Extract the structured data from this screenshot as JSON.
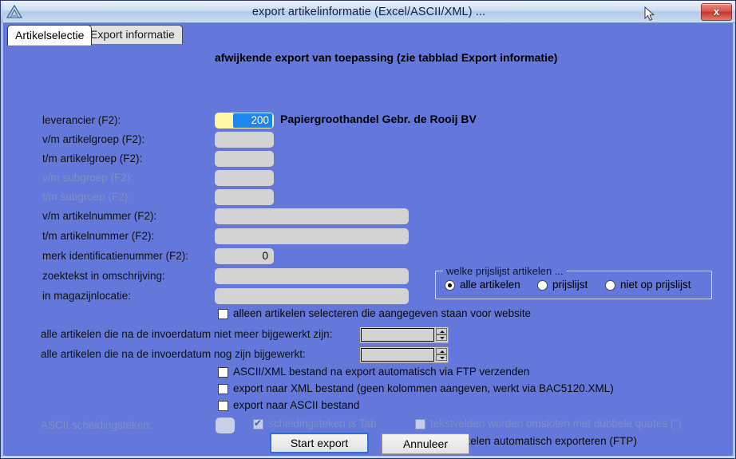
{
  "window": {
    "title": "export artikelinformatie (Excel/ASCII/XML) ...",
    "close_label": "x",
    "app_icon": "triangle-logo-icon"
  },
  "tabs": [
    {
      "label": "Artikelselectie",
      "active": true
    },
    {
      "label": "Export informatie",
      "active": false
    }
  ],
  "header_note": "afwijkende export van toepassing (zie tabblad Export informatie)",
  "fields": {
    "leverancier": {
      "label": "leverancier (F2):",
      "value": "200",
      "selected": true,
      "supplier_name": "Papiergroothandel Gebr. de Rooij BV"
    },
    "vm_artikelgroep": {
      "label": "v/m artikelgroep (F2):",
      "value": ""
    },
    "tm_artikelgroep": {
      "label": "t/m artikelgroep (F2):",
      "value": ""
    },
    "vm_subgroep": {
      "label": "v/m subgroep (F2):",
      "value": "",
      "disabled": true
    },
    "tm_subgroep": {
      "label": "t/m subgroep (F2):",
      "value": "",
      "disabled": true
    },
    "vm_artikelnummer": {
      "label": "v/m artikelnummer (F2):",
      "value": ""
    },
    "tm_artikelnummer": {
      "label": "t/m artikelnummer (F2):",
      "value": ""
    },
    "merk_identificatienummer": {
      "label": "merk identificatienummer (F2):",
      "value": "0"
    },
    "zoektekst": {
      "label": "zoektekst in omschrijving:",
      "value": ""
    },
    "magazijnlocatie": {
      "label": "in magazijnlocatie:",
      "value": ""
    }
  },
  "prijslijst_group": {
    "title": "welke prijslijst artikelen ...",
    "options": [
      {
        "label": "alle artikelen",
        "checked": true
      },
      {
        "label": "prijslijst",
        "checked": false
      },
      {
        "label": "niet op prijslijst",
        "checked": false
      }
    ]
  },
  "checkboxes": {
    "website": {
      "label": "alleen artikelen selecteren die aangegeven staan voor website",
      "checked": false
    },
    "ftp_send": {
      "label": "ASCII/XML bestand na export automatisch via FTP verzenden",
      "checked": false
    },
    "xml_export": {
      "label": "export naar XML bestand (geen kolommen aangeven, werkt via BAC5120.XML)",
      "checked": false
    },
    "ascii_export": {
      "label": "export naar ASCII bestand",
      "checked": false
    },
    "tab_separator": {
      "label": "scheidingsteken is Tab",
      "checked": true,
      "disabled": true
    },
    "double_quotes": {
      "label": "tekstvelden worden omsloten met dubbele quotes (\")",
      "checked": false,
      "disabled": true
    },
    "auto_export_ftp": {
      "label": "alle artikelen automatisch exporteren (FTP)",
      "checked": false
    }
  },
  "date_filters": {
    "not_updated": {
      "label": "alle artikelen die na de invoerdatum niet meer bijgewerkt zijn:",
      "value": ""
    },
    "still_updated": {
      "label": "alle artikelen die na de invoerdatum nog zijn bijgewerkt:",
      "value": ""
    }
  },
  "ascii_separator": {
    "label": "ASCII scheidingsteken:",
    "value": "",
    "disabled": true
  },
  "buttons": {
    "start": "Start export",
    "cancel": "Annuleer"
  },
  "colors": {
    "background": "#6378da",
    "field": "#d3d3d3",
    "focus_field": "#fdf8a8",
    "selection": "#1c86ee",
    "close_button": "#d9564a"
  }
}
